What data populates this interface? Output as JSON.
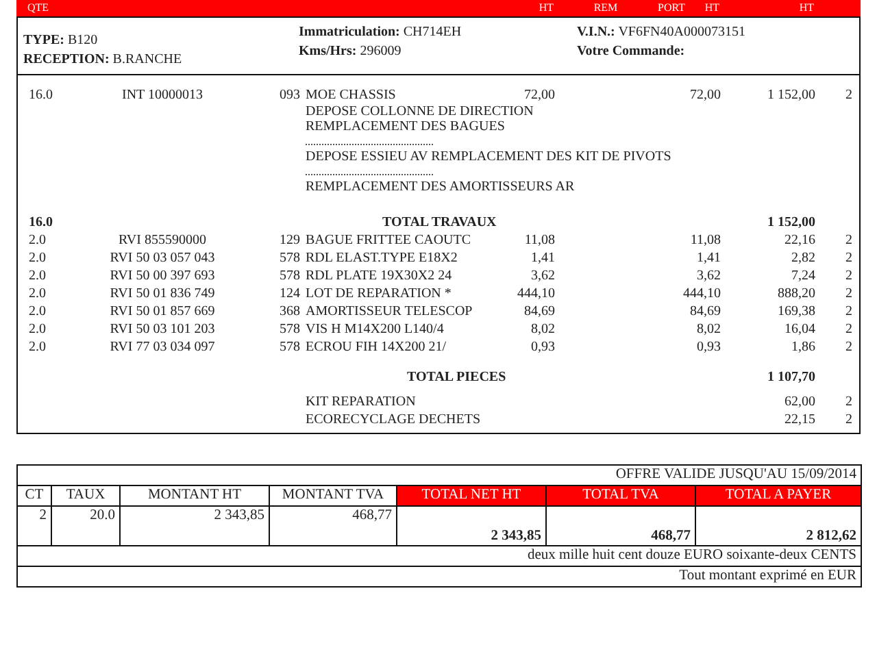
{
  "header_bar": {
    "labels": [
      {
        "text": "QTE",
        "kind": "qty"
      },
      {
        "text": "HT",
        "kind": "price"
      },
      {
        "text": "REM",
        "kind": "rem"
      },
      {
        "text": "PORT",
        "kind": "port"
      },
      {
        "text": "HT",
        "kind": "price_net"
      },
      {
        "text": "HT",
        "kind": "total"
      }
    ]
  },
  "info": {
    "left": [
      {
        "label": "TYPE:",
        "value": "B120"
      },
      {
        "label": "RECEPTION:",
        "value": "B.RANCHE"
      }
    ],
    "middle": [
      {
        "label": "Immatriculation:",
        "value": "CH714EH"
      },
      {
        "label": "Kms/Hrs:",
        "value": "296009"
      }
    ],
    "right": [
      {
        "label": "V.I.N.:",
        "value": "VF6FN40A000073151"
      },
      {
        "label": "Votre Commande:"
      }
    ]
  },
  "work": {
    "qty": "16.0",
    "ref": "INT  10000013",
    "code": "093",
    "description": "MOE CHASSIS",
    "price": "72,00",
    "price_net": "72,00",
    "total": "1 152,00",
    "vat": "2",
    "detail_groups": [
      [
        "DEPOSE COLLONNE DE DIRECTION",
        "REMPLACEMENT DES BAGUES"
      ],
      [
        "DEPOSE ESSIEU AV REMPLACEMENT DES KIT DE PIVOTS"
      ],
      [
        "REMPLACEMENT DES AMORTISSEURS AR"
      ]
    ]
  },
  "labor_total": {
    "qty": "16.0",
    "label": "TOTAL TRAVAUX",
    "amount": "1 152,00"
  },
  "parts": [
    {
      "qty": "2.0",
      "ref": "RVI 855590000",
      "code": "129",
      "description": "BAGUE FRITTEE CAOUTC",
      "price": "11,08",
      "price_net": "11,08",
      "total": "22,16",
      "vat": "2"
    },
    {
      "qty": "2.0",
      "ref": "RVI 50 03 057 043",
      "code": "578",
      "description": "RDL ELAST.TYPE E18X2",
      "price": "1,41",
      "price_net": "1,41",
      "total": "2,82",
      "vat": "2"
    },
    {
      "qty": "2.0",
      "ref": "RVI 50 00 397 693",
      "code": "578",
      "description": "RDL PLATE 19X30X2 24",
      "price": "3,62",
      "price_net": "3,62",
      "total": "7,24",
      "vat": "2"
    },
    {
      "qty": "2.0",
      "ref": "RVI 50 01 836 749",
      "code": "124",
      "description": "LOT DE REPARATION *",
      "price": "444,10",
      "price_net": "444,10",
      "total": "888,20",
      "vat": "2"
    },
    {
      "qty": "2.0",
      "ref": "RVI 50 01 857 669",
      "code": "368",
      "description": "AMORTISSEUR TELESCOP",
      "price": "84,69",
      "price_net": "84,69",
      "total": "169,38",
      "vat": "2"
    },
    {
      "qty": "2.0",
      "ref": "RVI 50 03 101 203",
      "code": "578",
      "description": "VIS H M14X200 L140/4",
      "price": "8,02",
      "price_net": "8,02",
      "total": "16,04",
      "vat": "2"
    },
    {
      "qty": "2.0",
      "ref": "RVI 77 03 034 097",
      "code": "578",
      "description": "ECROU FIH 14X200 21/",
      "price": "0,93",
      "price_net": "0,93",
      "total": "1,86",
      "vat": "2"
    }
  ],
  "parts_total": {
    "label": "TOTAL PIECES",
    "amount": "1 107,70"
  },
  "fees": [
    {
      "label": "KIT REPARATION",
      "amount": "62,00",
      "vat": "2"
    },
    {
      "label": "ECORECYCLAGE DECHETS",
      "amount": "22,15",
      "vat": "2"
    }
  ],
  "summary": {
    "validity": "OFFRE VALIDE JUSQU'AU 15/09/2014",
    "columns": [
      {
        "label": "CT",
        "highlighted": false
      },
      {
        "label": "TAUX",
        "highlighted": false
      },
      {
        "label": "MONTANT HT",
        "highlighted": false
      },
      {
        "label": "MONTANT TVA",
        "highlighted": false
      },
      {
        "label": "TOTAL NET HT",
        "highlighted": true
      },
      {
        "label": "TOTAL TVA",
        "highlighted": true
      },
      {
        "label": "TOTAL A PAYER",
        "highlighted": true
      }
    ],
    "values": [
      "2",
      "20.0",
      "2 343,85",
      "468,77",
      "2 343,85",
      "468,77",
      "2 812,62"
    ],
    "amount_in_words": "deux mille huit cent douze EURO soixante-deux CENTS",
    "footnote": "Tout montant exprimé en EUR"
  }
}
